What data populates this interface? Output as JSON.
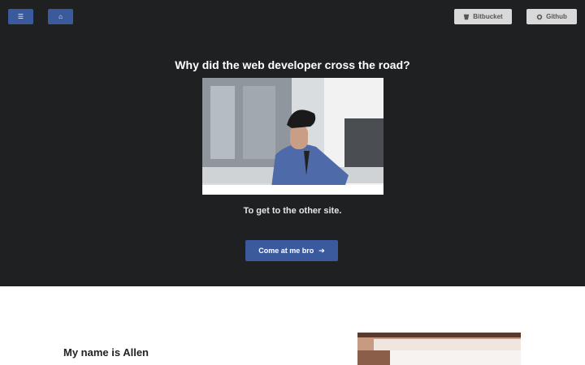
{
  "nav": {
    "menu_icon": "☰",
    "home_icon": "⌂",
    "bitbucket_label": "Bitbucket",
    "github_label": "Github"
  },
  "hero": {
    "title": "Why did the web developer cross the road?",
    "punchline": "To get to the other site.",
    "cta_label": "Come at me bro",
    "cta_icon": "➔"
  },
  "about": {
    "title": "My name is Allen"
  },
  "colors": {
    "hero_bg": "#1f2022",
    "accent": "#3b5a9d",
    "secondary_btn": "#d9d9d9"
  }
}
